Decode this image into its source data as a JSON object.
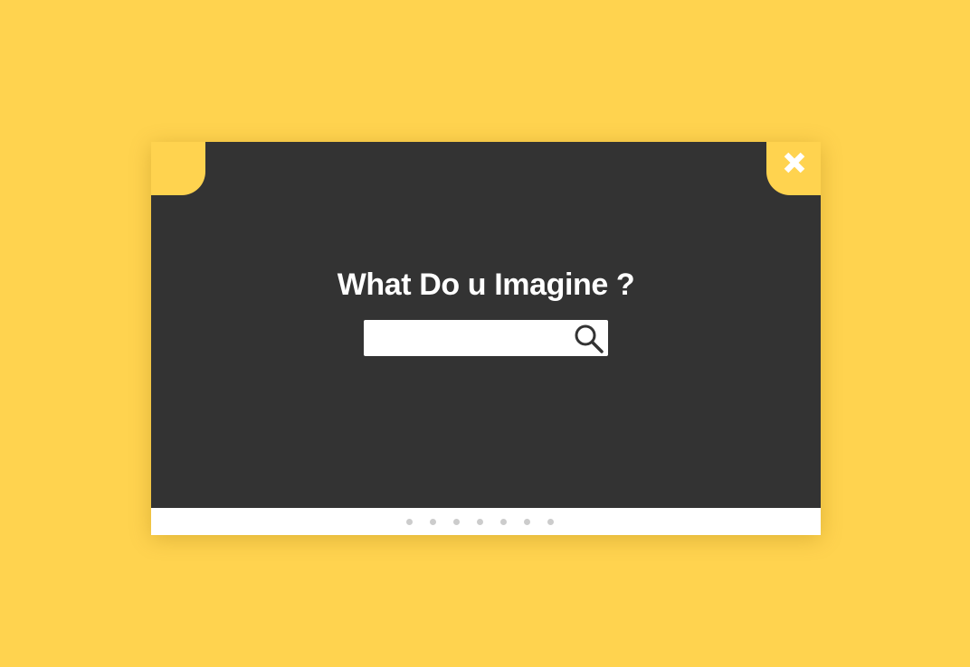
{
  "modal": {
    "title": "What Do u Imagine ?",
    "close_icon": "close-icon",
    "search": {
      "value": "",
      "placeholder": "",
      "icon": "search-icon"
    },
    "pager": {
      "dot_count": 7
    }
  },
  "colors": {
    "background": "#FFD34F",
    "modal": "#333333",
    "footer": "#FFFFFF",
    "dot": "#CCCCCC",
    "title": "#FFFFFF"
  }
}
